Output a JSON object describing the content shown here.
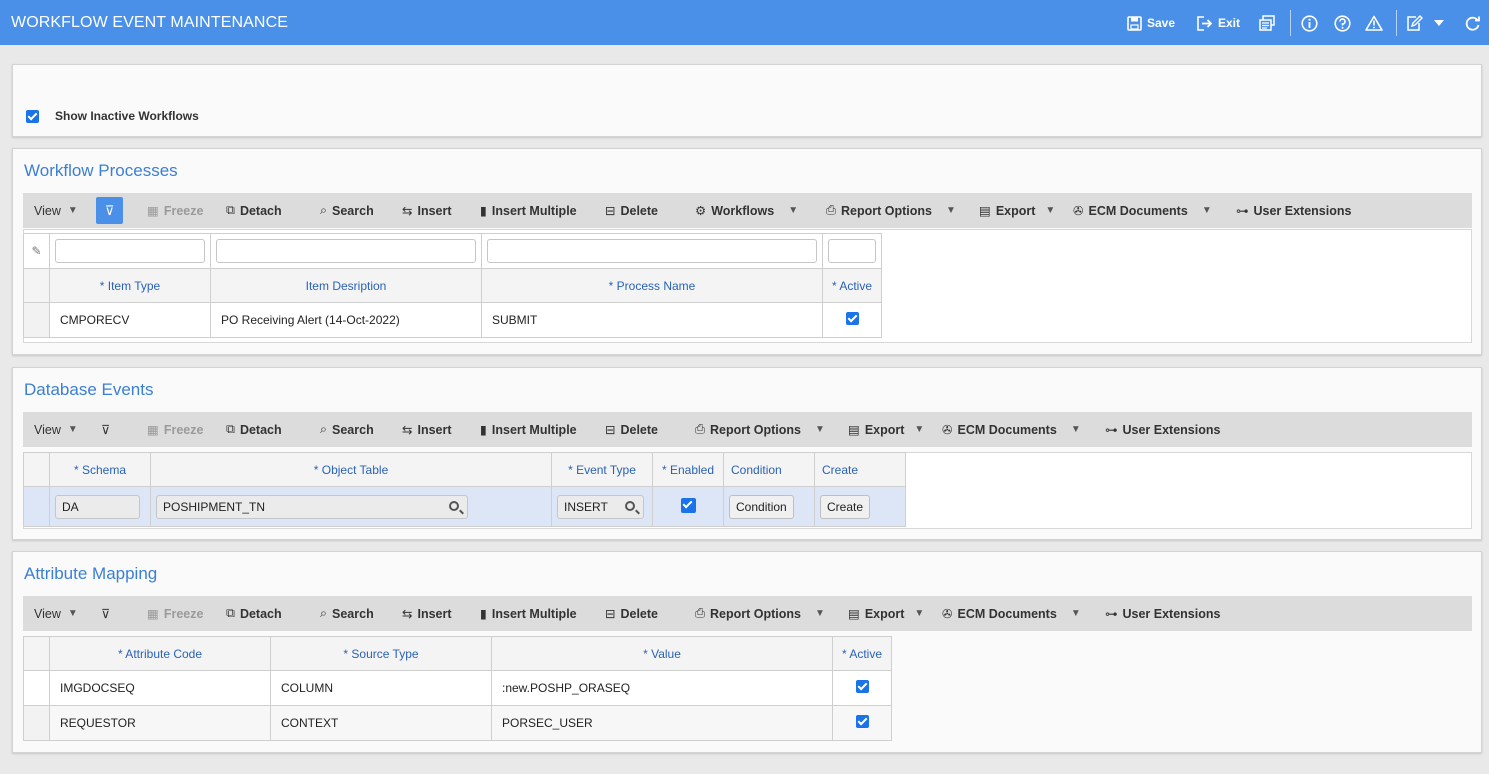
{
  "header": {
    "title": "WORKFLOW EVENT MAINTENANCE",
    "save_label": "Save",
    "exit_label": "Exit"
  },
  "options": {
    "show_inactive_label": "Show Inactive Workflows",
    "show_inactive_checked": true
  },
  "toolbar": {
    "view": "View",
    "freeze": "Freeze",
    "detach": "Detach",
    "search": "Search",
    "insert": "Insert",
    "insert_multiple": "Insert Multiple",
    "delete": "Delete",
    "workflows": "Workflows",
    "report_options": "Report Options",
    "export": "Export",
    "ecm_documents": "ECM Documents",
    "user_extensions": "User Extensions"
  },
  "workflow_processes": {
    "title": "Workflow Processes",
    "columns": [
      "* Item Type",
      "Item Desription",
      "* Process Name",
      "* Active"
    ],
    "rows": [
      {
        "item_type": "CMPORECV",
        "item_description": "PO Receiving Alert (14-Oct-2022)",
        "process_name": "SUBMIT",
        "active": true
      }
    ]
  },
  "database_events": {
    "title": "Database Events",
    "columns": [
      "* Schema",
      "* Object Table",
      "* Event Type",
      "* Enabled",
      "Condition",
      "Create"
    ],
    "rows": [
      {
        "schema": "DA",
        "object_table": "POSHIPMENT_TN",
        "event_type": "INSERT",
        "enabled": true,
        "condition_button": "Condition",
        "create_button": "Create"
      }
    ]
  },
  "attribute_mapping": {
    "title": "Attribute Mapping",
    "columns": [
      "* Attribute Code",
      "* Source Type",
      "* Value",
      "* Active"
    ],
    "rows": [
      {
        "attribute_code": "IMGDOCSEQ",
        "source_type": "COLUMN",
        "value": ":new.POSHP_ORASEQ",
        "active": true
      },
      {
        "attribute_code": "REQUESTOR",
        "source_type": "CONTEXT",
        "value": "PORSEC_USER",
        "active": true
      }
    ]
  }
}
